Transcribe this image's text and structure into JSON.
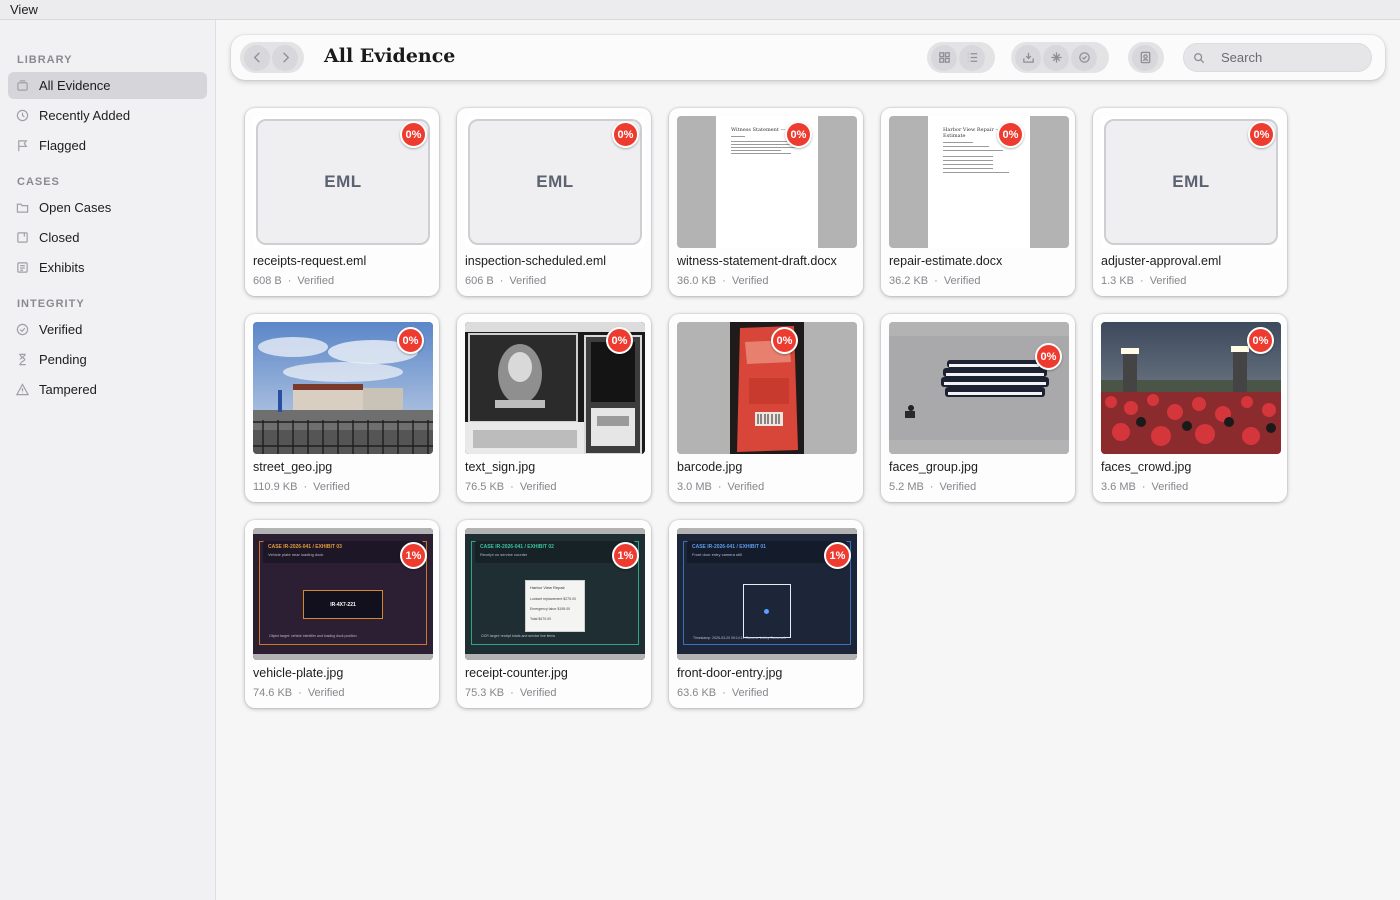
{
  "menubar": {
    "view_label": "View"
  },
  "sidebar": {
    "sections": [
      {
        "title": "LIBRARY",
        "items": [
          {
            "label": "All Evidence",
            "icon": "library-icon",
            "active": true
          },
          {
            "label": "Recently Added",
            "icon": "clock-icon"
          },
          {
            "label": "Flagged",
            "icon": "flag-icon"
          }
        ]
      },
      {
        "title": "CASES",
        "items": [
          {
            "label": "Open Cases",
            "icon": "folder-icon"
          },
          {
            "label": "Closed",
            "icon": "archive-icon"
          },
          {
            "label": "Exhibits",
            "icon": "exhibits-icon"
          }
        ]
      },
      {
        "title": "INTEGRITY",
        "items": [
          {
            "label": "Verified",
            "icon": "check-seal-icon"
          },
          {
            "label": "Pending",
            "icon": "hourglass-icon"
          },
          {
            "label": "Tampered",
            "icon": "warning-icon"
          }
        ]
      }
    ]
  },
  "toolbar": {
    "title": "All Evidence",
    "search_placeholder": "Search"
  },
  "cards": [
    {
      "name": "receipts-request.eml",
      "size": "608 B",
      "status": "Verified",
      "badge": "0%",
      "kind": "eml",
      "thumb_label": "EML"
    },
    {
      "name": "inspection-scheduled.eml",
      "size": "606 B",
      "status": "Verified",
      "badge": "0%",
      "kind": "eml",
      "thumb_label": "EML"
    },
    {
      "name": "witness-statement-draft.docx",
      "size": "36.0 KB",
      "status": "Verified",
      "badge": "0%",
      "kind": "docx",
      "doc_heading": "Witness Statement — Draft"
    },
    {
      "name": "repair-estimate.docx",
      "size": "36.2 KB",
      "status": "Verified",
      "badge": "0%",
      "kind": "docx",
      "doc_heading": "Harbor View Repair — Water Estimate"
    },
    {
      "name": "adjuster-approval.eml",
      "size": "1.3 KB",
      "status": "Verified",
      "badge": "0%",
      "kind": "eml",
      "thumb_label": "EML"
    },
    {
      "name": "street_geo.jpg",
      "size": "110.9 KB",
      "status": "Verified",
      "badge": "0%",
      "kind": "photo-street"
    },
    {
      "name": "text_sign.jpg",
      "size": "76.5 KB",
      "status": "Verified",
      "badge": "0%",
      "kind": "photo-window"
    },
    {
      "name": "barcode.jpg",
      "size": "3.0 MB",
      "status": "Verified",
      "badge": "0%",
      "kind": "photo-bag"
    },
    {
      "name": "faces_group.jpg",
      "size": "5.2 MB",
      "status": "Verified",
      "badge": "0%",
      "kind": "photo-group"
    },
    {
      "name": "faces_crowd.jpg",
      "size": "3.6 MB",
      "status": "Verified",
      "badge": "0%",
      "kind": "photo-crowd"
    },
    {
      "name": "vehicle-plate.jpg",
      "size": "74.6 KB",
      "status": "Verified",
      "badge": "1%",
      "kind": "exhibit-plate",
      "exhibit_title": "CASE IR-2026-041 / EXHIBIT 03",
      "exhibit_sub": "Vehicle plate near loading dock",
      "exhibit_plate": "IR-4X7-221",
      "exhibit_foot": "Object target: vehicle identifier and loading dock position"
    },
    {
      "name": "receipt-counter.jpg",
      "size": "75.3 KB",
      "status": "Verified",
      "badge": "1%",
      "kind": "exhibit-receipt",
      "exhibit_title": "CASE IR-2026-041 / EXHIBIT 02",
      "exhibit_sub": "Receipt on service counter",
      "exhibit_receipt_head": "Harbor View Repair",
      "exhibit_receipt_lines": [
        "Lockset replacement  $275.00",
        "Emergency labor  $195.00",
        "Total  $470.00"
      ],
      "exhibit_foot": "OCR target: receipt totals and service line items"
    },
    {
      "name": "front-door-entry.jpg",
      "size": "63.6 KB",
      "status": "Verified",
      "badge": "1%",
      "kind": "exhibit-door",
      "exhibit_title": "CASE IR-2026-041 / EXHIBIT 01",
      "exhibit_sub": "Front door entry camera still",
      "exhibit_foot": "Timestamp: 2026-03-20 09:14:11  Camera: Lobby Camera A"
    }
  ]
}
